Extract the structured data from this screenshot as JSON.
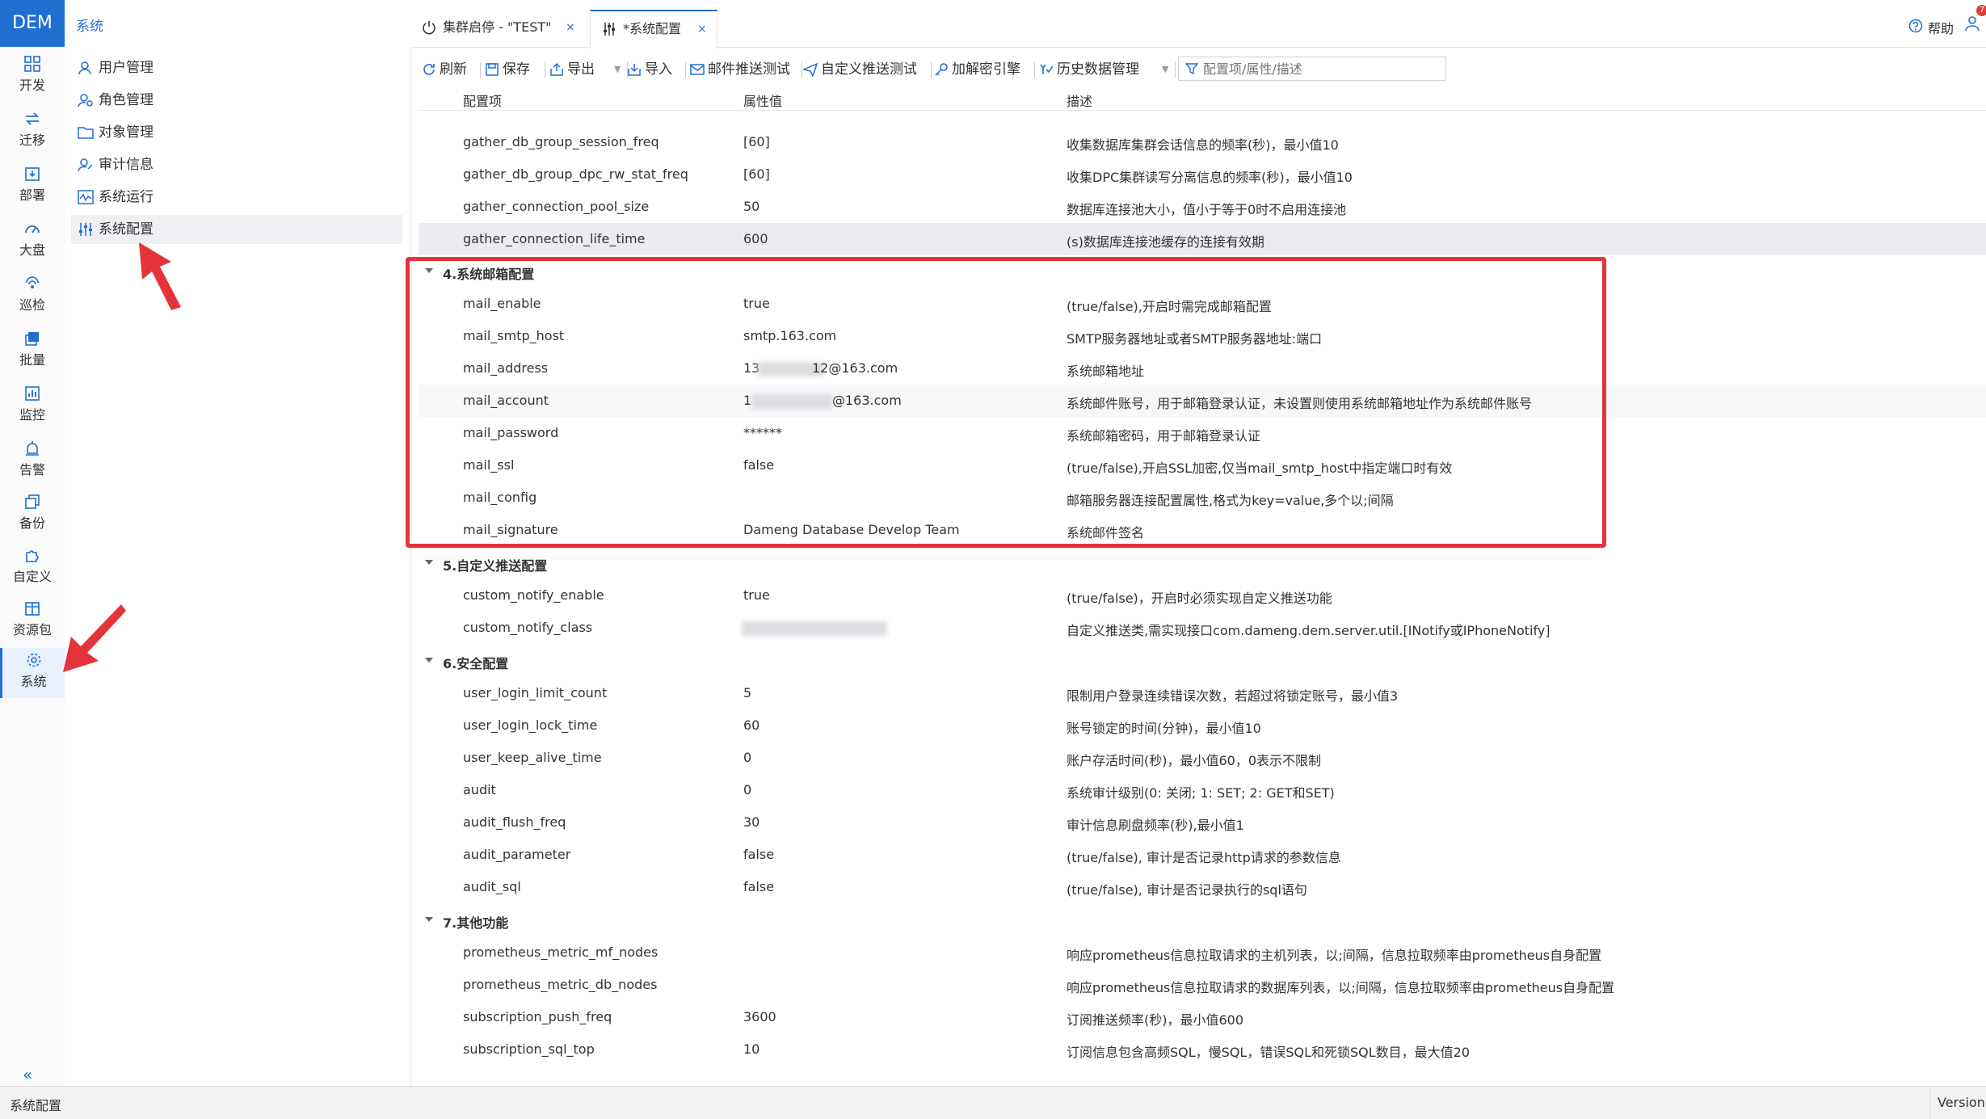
{
  "app": {
    "logo": "DEM",
    "section_title": "系统"
  },
  "colors": {
    "accent": "#1f6fd1",
    "highlight_border": "#e5333b",
    "arrow": "#e5333b"
  },
  "rail": {
    "items": [
      {
        "label": "开发",
        "icon": "grid-icon"
      },
      {
        "label": "迁移",
        "icon": "migrate-icon"
      },
      {
        "label": "部署",
        "icon": "deploy-icon"
      },
      {
        "label": "大盘",
        "icon": "gauge-icon"
      },
      {
        "label": "巡检",
        "icon": "inspect-icon"
      },
      {
        "label": "批量",
        "icon": "batch-icon"
      },
      {
        "label": "监控",
        "icon": "monitor-chart-icon"
      },
      {
        "label": "告警",
        "icon": "alarm-icon"
      },
      {
        "label": "备份",
        "icon": "backup-icon"
      },
      {
        "label": "自定义",
        "icon": "puzzle-icon"
      },
      {
        "label": "资源包",
        "icon": "package-icon"
      },
      {
        "label": "系统",
        "icon": "gear-icon"
      }
    ],
    "collapse": "«"
  },
  "subnav": {
    "items": [
      {
        "label": "用户管理",
        "icon": "user-icon"
      },
      {
        "label": "角色管理",
        "icon": "role-icon"
      },
      {
        "label": "对象管理",
        "icon": "folder-icon"
      },
      {
        "label": "审计信息",
        "icon": "audit-icon"
      },
      {
        "label": "系统运行",
        "icon": "pulse-icon"
      },
      {
        "label": "系统配置",
        "icon": "settings-sliders-icon"
      }
    ]
  },
  "tabs": [
    {
      "label": "集群启停 - \"TEST\"",
      "icon": "power-icon",
      "close": "×"
    },
    {
      "label": "*系统配置",
      "icon": "settings-sliders-icon",
      "close": "×"
    }
  ],
  "header": {
    "help": "帮助",
    "badge": "7"
  },
  "toolbar": {
    "refresh": "刷新",
    "save": "保存",
    "export": "导出",
    "import": "导入",
    "mail_test": "邮件推送测试",
    "custom_test": "自定义推送测试",
    "decrypt": "加解密引擎",
    "history": "历史数据管理",
    "filter_placeholder": "配置项/属性/描述"
  },
  "grid": {
    "headers": [
      "配置项",
      "属性值",
      "描述"
    ],
    "rows_before": [
      {
        "key": "gather_db_group_session_freq",
        "value": "[60]",
        "desc": "收集数据库集群会话信息的频率(秒)，最小值10"
      },
      {
        "key": "gather_db_group_dpc_rw_stat_freq",
        "value": "[60]",
        "desc": "收集DPC集群读写分离信息的频率(秒)，最小值10"
      },
      {
        "key": "gather_connection_pool_size",
        "value": "50",
        "desc": "数据库连接池大小，值小于等于0时不启用连接池"
      },
      {
        "key": "gather_connection_life_time",
        "value": "600",
        "desc": "(s)数据库连接池缓存的连接有效期"
      }
    ],
    "groups": [
      {
        "title": "4.系统邮箱配置",
        "rows": [
          {
            "key": "mail_enable",
            "value": "true",
            "desc": "(true/false),开启时需完成邮箱配置"
          },
          {
            "key": "mail_smtp_host",
            "value": "smtp.163.com",
            "desc": "SMTP服务器地址或者SMTP服务器地址:端口"
          },
          {
            "key": "mail_address",
            "value_prefix": "13",
            "value_suffix": "12@163.com",
            "desc": "系统邮箱地址"
          },
          {
            "key": "mail_account",
            "value_prefix": "1",
            "value_suffix": "@163.com",
            "desc": "系统邮件账号，用于邮箱登录认证，未设置则使用系统邮箱地址作为系统邮件账号"
          },
          {
            "key": "mail_password",
            "value": "******",
            "desc": "系统邮箱密码，用于邮箱登录认证"
          },
          {
            "key": "mail_ssl",
            "value": "false",
            "desc": "(true/false),开启SSL加密,仅当mail_smtp_host中指定端口时有效"
          },
          {
            "key": "mail_config",
            "value": "",
            "desc": "邮箱服务器连接配置属性,格式为key=value,多个以;间隔"
          },
          {
            "key": "mail_signature",
            "value": "Dameng Database Develop Team",
            "desc": "系统邮件签名"
          }
        ]
      },
      {
        "title": "5.自定义推送配置",
        "rows": [
          {
            "key": "custom_notify_enable",
            "value": "true",
            "desc": "(true/false)，开启时必须实现自定义推送功能"
          },
          {
            "key": "custom_notify_class",
            "value": "",
            "desc": "自定义推送类,需实现接口com.dameng.dem.server.util.[INotify或IPhoneNotify]"
          }
        ]
      },
      {
        "title": "6.安全配置",
        "rows": [
          {
            "key": "user_login_limit_count",
            "value": "5",
            "desc": "限制用户登录连续错误次数，若超过将锁定账号，最小值3"
          },
          {
            "key": "user_login_lock_time",
            "value": "60",
            "desc": "账号锁定的时间(分钟)，最小值10"
          },
          {
            "key": "user_keep_alive_time",
            "value": "0",
            "desc": "账户存活时间(秒)，最小值60，0表示不限制"
          },
          {
            "key": "audit",
            "value": "0",
            "desc": "系统审计级别(0: 关闭; 1: SET; 2: GET和SET)"
          },
          {
            "key": "audit_flush_freq",
            "value": "30",
            "desc": "审计信息刷盘频率(秒),最小值1"
          },
          {
            "key": "audit_parameter",
            "value": "false",
            "desc": "(true/false), 审计是否记录http请求的参数信息"
          },
          {
            "key": "audit_sql",
            "value": "false",
            "desc": "(true/false), 审计是否记录执行的sql语句"
          }
        ]
      },
      {
        "title": "7.其他功能",
        "rows": [
          {
            "key": "prometheus_metric_mf_nodes",
            "value": "",
            "desc": "响应prometheus信息拉取请求的主机列表，以;间隔，信息拉取频率由prometheus自身配置"
          },
          {
            "key": "prometheus_metric_db_nodes",
            "value": "",
            "desc": "响应prometheus信息拉取请求的数据库列表，以;间隔，信息拉取频率由prometheus自身配置"
          },
          {
            "key": "subscription_push_freq",
            "value": "3600",
            "desc": "订阅推送频率(秒)，最小值600"
          },
          {
            "key": "subscription_sql_top",
            "value": "10",
            "desc": "订阅信息包含高频SQL，慢SQL，错误SQL和死锁SQL数目，最大值20"
          }
        ]
      }
    ]
  },
  "statusbar": {
    "left": "系统配置",
    "right": "Version:"
  }
}
